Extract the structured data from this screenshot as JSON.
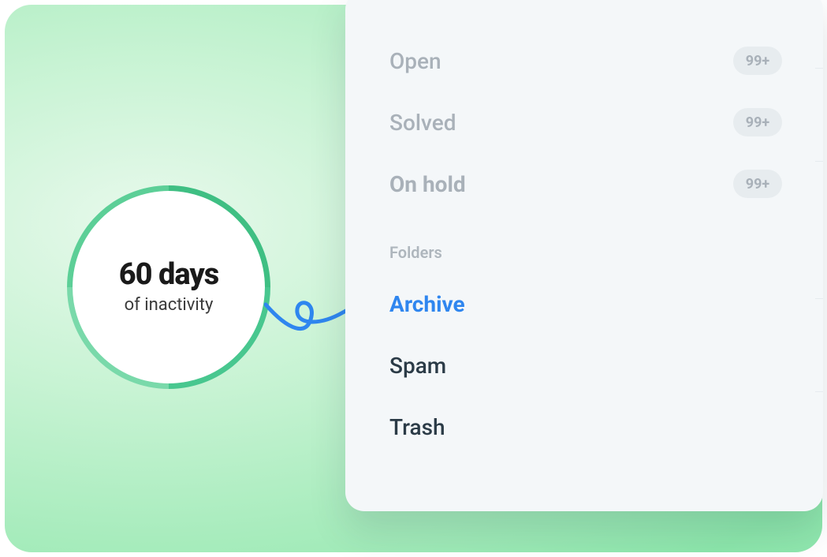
{
  "callout": {
    "headline": "60 days",
    "subline": "of inactivity"
  },
  "statuses": [
    {
      "label": "Open",
      "count": "99+",
      "bold": false
    },
    {
      "label": "Solved",
      "count": "99+",
      "bold": false
    },
    {
      "label": "On hold",
      "count": "99+",
      "bold": true
    }
  ],
  "folders_section_title": "Folders",
  "folders": [
    {
      "label": "Archive",
      "active": true
    },
    {
      "label": "Spam",
      "active": false
    },
    {
      "label": "Trash",
      "active": false
    }
  ]
}
